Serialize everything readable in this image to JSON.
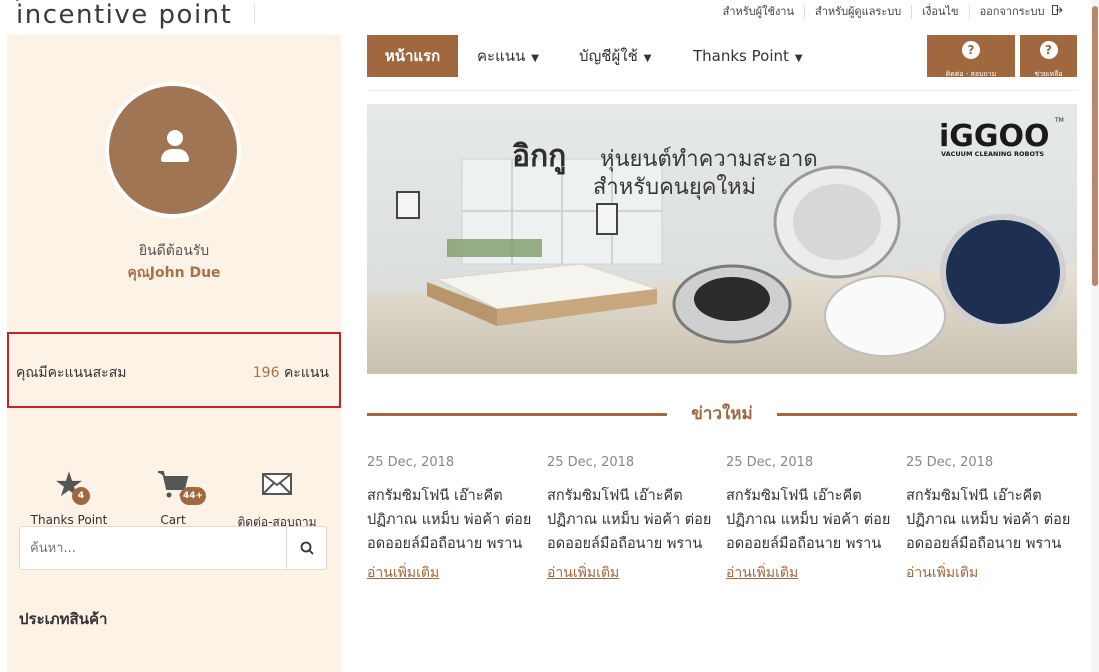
{
  "brand": {
    "logo_text": "incentive point",
    "logo_dot": "·"
  },
  "top_links": [
    {
      "label": "สำหรับผู้ใช้งาน"
    },
    {
      "label": "สำหรับผู้ดูแลระบบ"
    },
    {
      "label": "เงื่อนไข"
    },
    {
      "label": "ออกจากระบบ"
    }
  ],
  "profile": {
    "welcome": "ยินดีต้อนรับ",
    "name": "คุณJohn Due"
  },
  "points": {
    "label": "คุณมีคะแนนสะสม",
    "value": "196",
    "unit": "คะแนน"
  },
  "quick_links": [
    {
      "label": "Thanks Point",
      "badge": "4",
      "icon": "star-icon"
    },
    {
      "label": "Cart",
      "badge": "44+",
      "icon": "cart-icon"
    },
    {
      "label": "ติดต่อ-สอบถาม",
      "badge": "",
      "icon": "mail-icon"
    }
  ],
  "search": {
    "placeholder": "ค้นหา..."
  },
  "category_title": "ประเภทสินค้า",
  "nav": {
    "home": "หน้าแรก",
    "points": "คะแนน",
    "account": "บัญชีผู้ใช้",
    "thanks": "Thanks Point",
    "contact_btn": "ติดต่อ - สอบถาม",
    "help_btn": "ช่วยเหลือ",
    "question_mark": "?"
  },
  "banner": {
    "brand": "iGGOO",
    "tm": "TM",
    "brand_sub": "VACUUM CLEANING ROBOTS",
    "headline_big": "อิกกู",
    "headline_1": "หุ่นยนต์ทำความสะอาด",
    "headline_2": "สำหรับคนยุคใหม่"
  },
  "news": {
    "title": "ข่าวใหม่",
    "items": [
      {
        "date": "25 Dec, 2018",
        "text": "สกรัมซิมโฟนี เอ๊าะคีต ปฏิภาณ แหม็บ พ่อค้า ต่อยอดออยล์มือถือนาย พราน",
        "more": "อ่านเพิ่มเติม"
      },
      {
        "date": "25 Dec, 2018",
        "text": "สกรัมซิมโฟนี เอ๊าะคีต ปฏิภาณ แหม็บ พ่อค้า ต่อยอดออยล์มือถือนาย พราน",
        "more": "อ่านเพิ่มเติม"
      },
      {
        "date": "25 Dec, 2018",
        "text": "สกรัมซิมโฟนี เอ๊าะคีต ปฏิภาณ แหม็บ พ่อค้า ต่อยอดออยล์มือถือนาย พราน",
        "more": "อ่านเพิ่มเติม"
      },
      {
        "date": "25 Dec, 2018",
        "text": "สกรัมซิมโฟนี เอ๊าะคีต ปฏิภาณ แหม็บ พ่อค้า ต่อยอดออยล์มือถือนาย พราน",
        "more": "อ่านเพิ่มเติม"
      }
    ]
  },
  "colors": {
    "accent": "#a0683f",
    "sidebar_bg": "#fdf2e6",
    "highlight_border": "#cc2121"
  }
}
